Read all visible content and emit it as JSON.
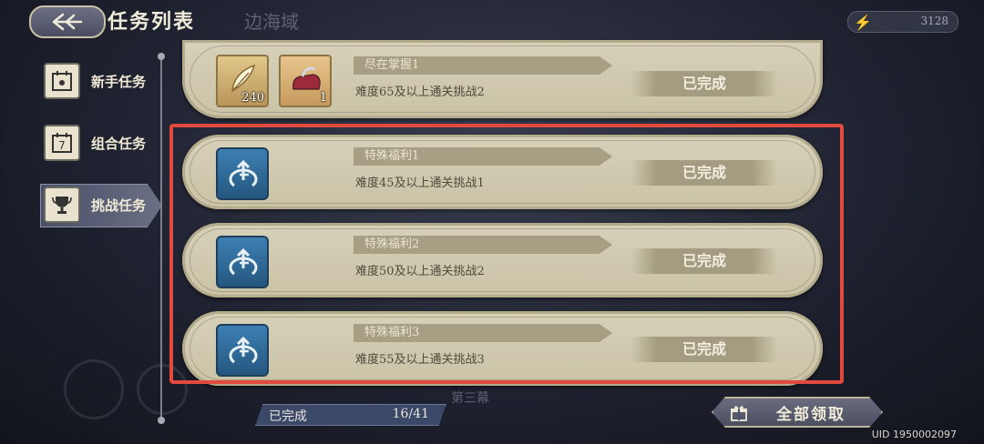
{
  "header": {
    "title": "任务列表",
    "bg_label": "边海域",
    "energy_value": "3128"
  },
  "sidebar": {
    "items": [
      {
        "label": "新手任务",
        "icon": "calendar-sun-icon"
      },
      {
        "label": "组合任务",
        "icon": "calendar-seven-icon",
        "icon_text": "7"
      },
      {
        "label": "挑战任务",
        "icon": "trophy-icon",
        "active": true
      }
    ]
  },
  "tasks": [
    {
      "title": "尽在掌握1",
      "desc": "难度65及以上通关挑战2",
      "status": "已完成",
      "rewards": [
        {
          "icon": "feather-icon",
          "count": "240"
        },
        {
          "icon": "bag-icon",
          "count": "1"
        }
      ]
    },
    {
      "title": "特殊福利1",
      "desc": "难度45及以上通关挑战1",
      "status": "已完成",
      "icon": "special-task-icon"
    },
    {
      "title": "特殊福利2",
      "desc": "难度50及以上通关挑战2",
      "status": "已完成",
      "icon": "special-task-icon"
    },
    {
      "title": "特殊福利3",
      "desc": "难度55及以上通关挑战3",
      "status": "已完成",
      "icon": "special-task-icon"
    }
  ],
  "footer": {
    "progress_label": "已完成",
    "progress_value": "16/41",
    "progress_fraction": 0.39,
    "claim_all_label": "全部领取",
    "uid": "UID 1950002097",
    "bg_text": "第三幕"
  },
  "colors": {
    "highlight": "#e34a3f",
    "card": "#d3ccb3",
    "accent_blue": "#2f6e9f"
  }
}
